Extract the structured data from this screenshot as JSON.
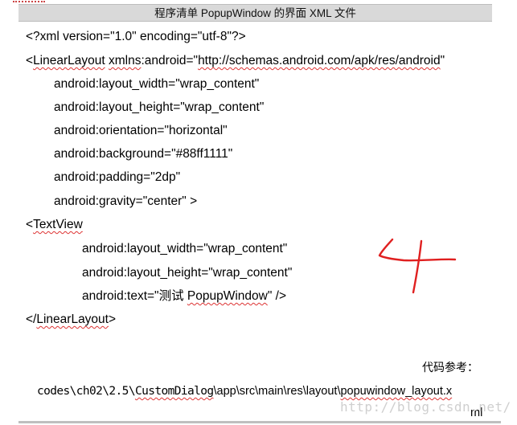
{
  "title": "程序清单 PopupWindow 的界面 XML 文件",
  "code": {
    "line1": "<?xml version=\"1.0\" encoding=\"utf-8\"?>",
    "line2_a": "<",
    "line2_b": "LinearLayout",
    "line2_c": " ",
    "line2_d": "xmlns",
    "line2_e": ":android=\"",
    "line2_f": "http://schemas.android.com/apk/res/android",
    "line2_g": "\"",
    "line3": "android:layout_width=\"wrap_content\"",
    "line4": "android:layout_height=\"wrap_content\"",
    "line5": "android:orientation=\"horizontal\"",
    "line6": "android:background=\"#88ff1111\"",
    "line7": "android:padding=\"2dp\"",
    "line8": "android:gravity=\"center\" >",
    "line9_a": "<",
    "line9_b": "TextView",
    "line10": "android:layout_width=\"wrap_content\"",
    "line11": "android:layout_height=\"wrap_content\"",
    "line12_a": "android:text=\"",
    "line12_b": "测试",
    "line12_c": " ",
    "line12_d": "PopupWindow",
    "line12_e": "\" />",
    "line13_a": "</",
    "line13_b": "LinearLayout",
    "line13_c": ">"
  },
  "reference": {
    "label": "代码参考：",
    "path_a": "codes\\ch02\\2.5\\",
    "path_b": "CustomDialog",
    "path_c": "\\app\\src\\main\\res\\layout\\",
    "path_d": "popuwindow_layout.x",
    "path_wrap": "ml"
  },
  "watermark": "http://blog.csdn.net/",
  "annotation": {
    "handwritten": "4",
    "color": "#e02020"
  }
}
